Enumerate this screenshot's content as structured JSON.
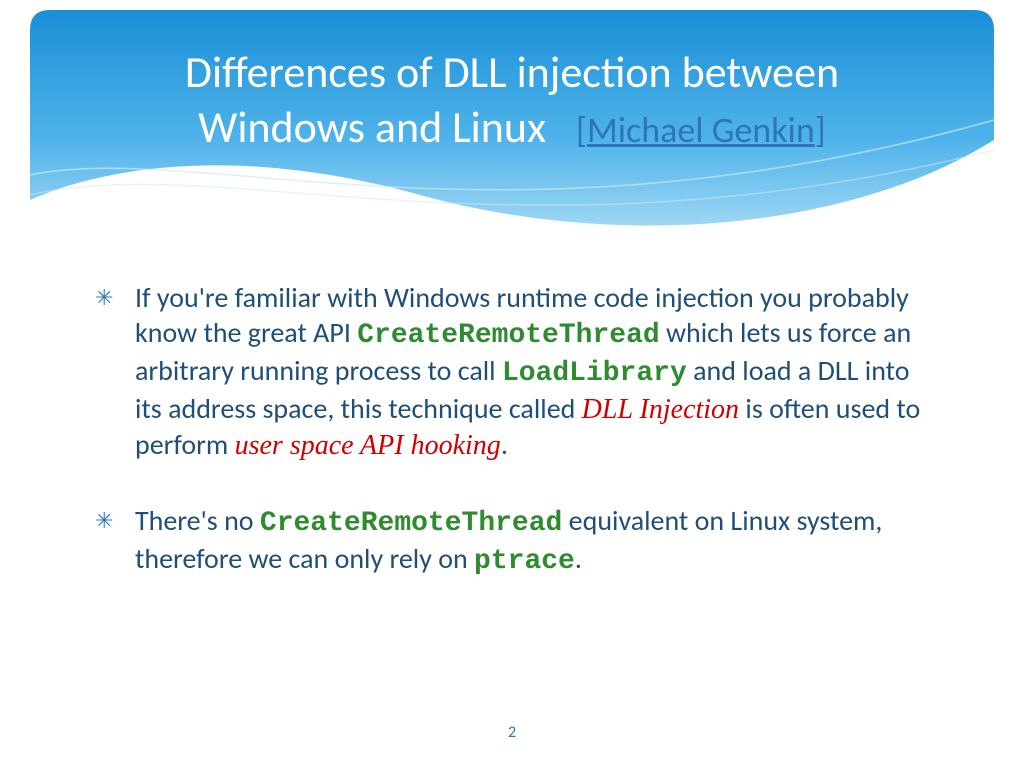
{
  "header": {
    "title_line1": "Differences of DLL injection between",
    "title_line2": "Windows and Linux",
    "bracket_open": "[",
    "author": "Michael Genkin",
    "bracket_close": "]"
  },
  "bullets": [
    {
      "segs": [
        {
          "t": "plain",
          "v": "If you're familiar with Windows runtime code injection you probably know the great API "
        },
        {
          "t": "mono",
          "v": "CreateRemoteThread"
        },
        {
          "t": "plain",
          "v": " which lets us force an arbitrary running process to call "
        },
        {
          "t": "mono",
          "v": "LoadLibrary"
        },
        {
          "t": "plain",
          "v": " and load a DLL into its address space, this technique called "
        },
        {
          "t": "red",
          "v": "DLL Injection"
        },
        {
          "t": "plain",
          "v": " is often used to perform "
        },
        {
          "t": "red",
          "v": "user space API hooking"
        },
        {
          "t": "plain",
          "v": "."
        }
      ]
    },
    {
      "segs": [
        {
          "t": "plain",
          "v": "There's no "
        },
        {
          "t": "mono",
          "v": "CreateRemoteThread"
        },
        {
          "t": "plain",
          "v": " equivalent on Linux system, therefore we can only rely on "
        },
        {
          "t": "mono",
          "v": "ptrace"
        },
        {
          "t": "plain",
          "v": "."
        }
      ]
    }
  ],
  "page_number": "2"
}
